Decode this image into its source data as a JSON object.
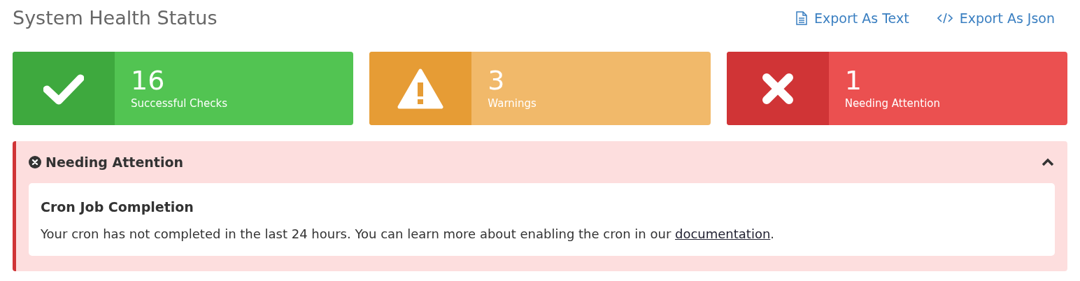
{
  "title": "System Health Status",
  "actions": [
    {
      "kind": "text",
      "label": "Export As Text"
    },
    {
      "kind": "json",
      "label": "Export As Json"
    }
  ],
  "cards": [
    {
      "kind": "success",
      "count": "16",
      "label": "Successful Checks"
    },
    {
      "kind": "warning",
      "count": "3",
      "label": "Warnings"
    },
    {
      "kind": "error",
      "count": "1",
      "label": "Needing Attention"
    }
  ],
  "section": {
    "title": "Needing Attention",
    "expanded": true,
    "items": [
      {
        "title": "Cron Job Completion",
        "text_before": "Your cron has not completed in the last 24 hours. You can learn more about enabling the cron in our ",
        "link": "documentation",
        "text_after": "."
      }
    ]
  }
}
